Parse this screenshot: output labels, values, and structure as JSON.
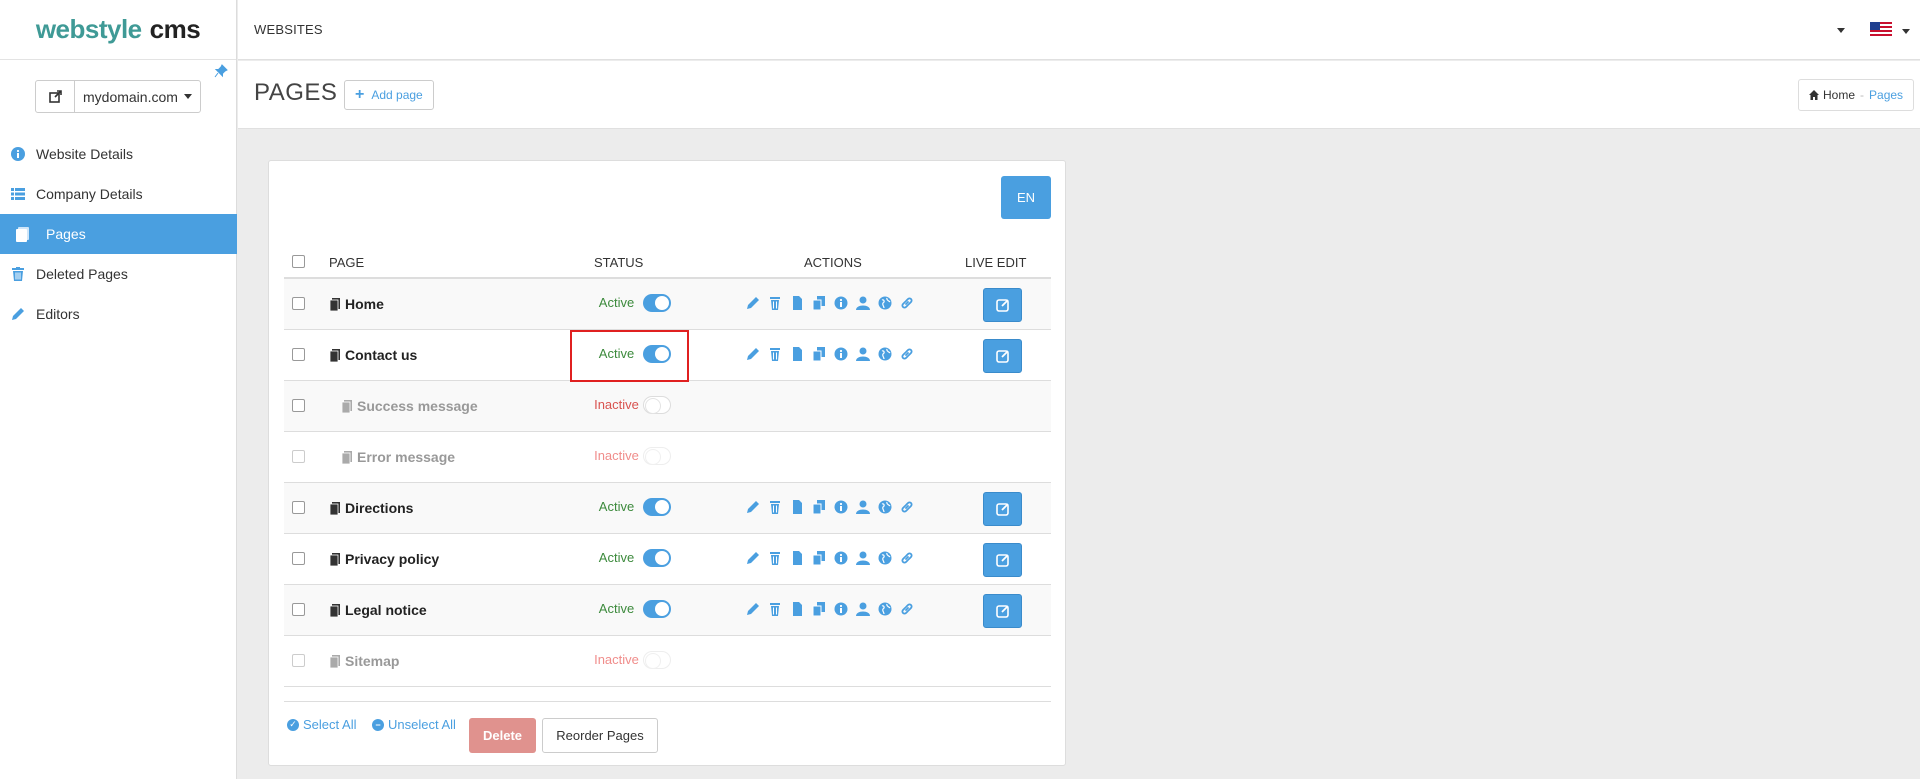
{
  "brand": {
    "part1": "webstyle",
    "part2": "cms"
  },
  "sidebar": {
    "domain": "mydomain.com",
    "items": [
      {
        "label": "Website Details",
        "icon": "info-circle-icon"
      },
      {
        "label": "Company Details",
        "icon": "list-icon"
      },
      {
        "label": "Pages",
        "icon": "pages-icon",
        "active": true
      },
      {
        "label": "Deleted Pages",
        "icon": "trash-icon"
      },
      {
        "label": "Editors",
        "icon": "pencil-icon"
      }
    ]
  },
  "topbar": {
    "title": "WEBSITES",
    "language_flag": "us-flag-icon"
  },
  "page": {
    "title": "PAGES",
    "add_label": "Add page",
    "breadcrumb": {
      "home": "Home",
      "current": "Pages"
    }
  },
  "table": {
    "language": "EN",
    "headers": {
      "page": "PAGE",
      "status": "STATUS",
      "actions": "ACTIONS",
      "live_edit": "LIVE EDIT"
    },
    "rows": [
      {
        "name": "Home",
        "status": "Active",
        "level": 0
      },
      {
        "name": "Contact us",
        "status": "Active",
        "level": 0
      },
      {
        "name": "Success message",
        "status": "Inactive",
        "level": 1
      },
      {
        "name": "Error message",
        "status": "Inactive",
        "level": 1
      },
      {
        "name": "Directions",
        "status": "Active",
        "level": 0
      },
      {
        "name": "Privacy policy",
        "status": "Active",
        "level": 0
      },
      {
        "name": "Legal notice",
        "status": "Active",
        "level": 0
      },
      {
        "name": "Sitemap",
        "status": "Inactive",
        "level": 0
      }
    ]
  },
  "footer": {
    "select_all": "Select All",
    "unselect_all": "Unselect All",
    "delete": "Delete",
    "reorder": "Reorder Pages"
  },
  "colors": {
    "accent": "#4a9fe0",
    "brand": "#3f9a96",
    "active": "#3c8a3c",
    "inactive": "#d9534f"
  }
}
